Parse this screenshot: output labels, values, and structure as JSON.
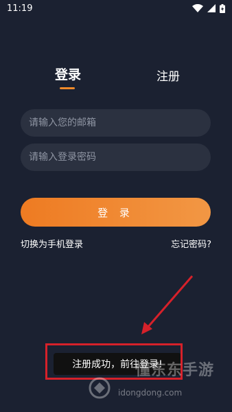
{
  "status_bar": {
    "time": "11:19",
    "icons": [
      "wifi-icon",
      "signal-icon",
      "battery-icon"
    ]
  },
  "tabs": [
    {
      "label": "登录",
      "active": true
    },
    {
      "label": "注册",
      "active": false
    }
  ],
  "form": {
    "email_placeholder": "请输入您的邮箱",
    "email_value": "",
    "password_placeholder": "请输入登录密码",
    "password_value": "",
    "login_button": "登 录"
  },
  "links": {
    "phone_login": "切换为手机登录",
    "forgot_password": "忘记密码?"
  },
  "toast": {
    "message": "注册成功，前往登录!"
  },
  "watermark": {
    "text": "懂东东手游",
    "url": "idongdong.com"
  },
  "colors": {
    "background": "#1b2131",
    "input_bg": "#2b3140",
    "accent": "#f08a2a",
    "annotation": "#d6212a"
  }
}
